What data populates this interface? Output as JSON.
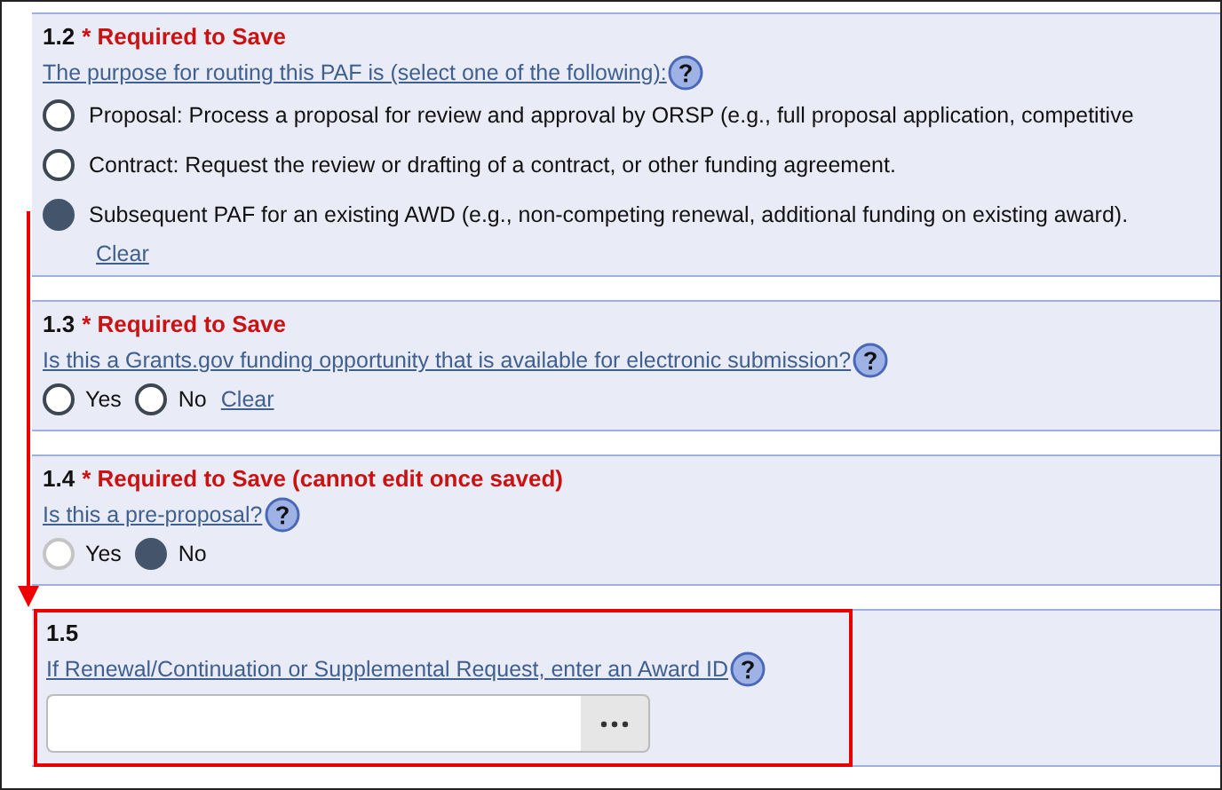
{
  "sections": [
    {
      "number": "1.2",
      "required": "* Required to Save",
      "question": "The purpose for routing this PAF is (select one of the following):",
      "kind": "stacked",
      "disabled": false,
      "highlighted": false,
      "clear": "Clear",
      "options": [
        {
          "label": "Proposal: Process a proposal for review and approval by ORSP (e.g., full proposal application, competitive",
          "selected": false
        },
        {
          "label": "Contract: Request the review or drafting of a contract, or other funding agreement.",
          "selected": false
        },
        {
          "label": "Subsequent PAF for an existing AWD (e.g., non-competing renewal, additional funding on existing award).",
          "selected": true
        }
      ]
    },
    {
      "number": "1.3",
      "required": "* Required to Save",
      "question": "Is this a Grants.gov funding opportunity that is available for electronic submission?",
      "kind": "inline",
      "disabled": false,
      "highlighted": false,
      "clear": "Clear",
      "options": [
        {
          "label": "Yes",
          "selected": false
        },
        {
          "label": "No",
          "selected": false
        }
      ]
    },
    {
      "number": "1.4",
      "required": "* Required to Save (cannot edit once saved)",
      "question": "Is this a pre-proposal?",
      "kind": "inline",
      "disabled": true,
      "highlighted": false,
      "options": [
        {
          "label": "Yes",
          "selected": false
        },
        {
          "label": "No",
          "selected": true
        }
      ]
    },
    {
      "number": "1.5",
      "question": "If Renewal/Continuation or Supplemental Request, enter an Award ID",
      "kind": "lookup",
      "highlighted": true
    }
  ]
}
